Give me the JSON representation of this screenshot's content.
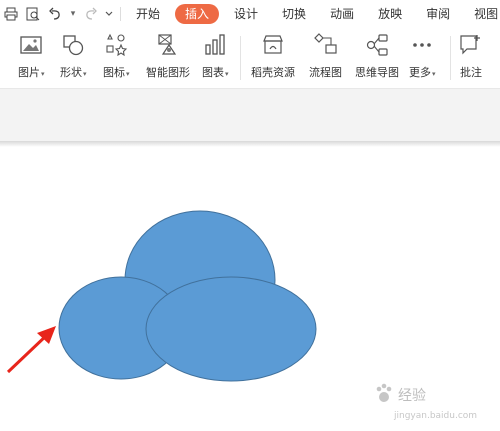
{
  "quick_access": {
    "print_icon": "printer-icon",
    "preview_icon": "print-preview-icon",
    "undo_icon": "undo-icon",
    "redo_icon": "redo-icon",
    "more_icon": "chevron-down-icon"
  },
  "tabs": [
    {
      "label": "开始",
      "active": false
    },
    {
      "label": "插入",
      "active": true
    },
    {
      "label": "设计",
      "active": false
    },
    {
      "label": "切换",
      "active": false
    },
    {
      "label": "动画",
      "active": false
    },
    {
      "label": "放映",
      "active": false
    },
    {
      "label": "审阅",
      "active": false
    },
    {
      "label": "视图",
      "active": false
    }
  ],
  "ribbon": {
    "picture": {
      "label": "图片",
      "icon": "picture-icon",
      "has_dropdown": true
    },
    "shape": {
      "label": "形状",
      "icon": "shape-icon",
      "has_dropdown": true
    },
    "icon": {
      "label": "图标",
      "icon": "icons-icon",
      "has_dropdown": true
    },
    "smartart": {
      "label": "智能图形",
      "icon": "smartart-icon",
      "has_dropdown": false
    },
    "chart": {
      "label": "图表",
      "icon": "chart-icon",
      "has_dropdown": true
    },
    "resources": {
      "label": "稻壳资源",
      "icon": "store-icon",
      "has_dropdown": false
    },
    "flowchart": {
      "label": "流程图",
      "icon": "flowchart-icon",
      "has_dropdown": false
    },
    "mindmap": {
      "label": "思维导图",
      "icon": "mindmap-icon",
      "has_dropdown": false
    },
    "more": {
      "label": "更多",
      "icon": "more-dots-icon",
      "has_dropdown": true
    },
    "comment": {
      "label": "批注",
      "icon": "comment-add-icon",
      "has_dropdown": false
    }
  },
  "slide": {
    "shape_fill": "#5b9bd5",
    "shape_stroke": "#41719c",
    "arrow_color": "#e8251b"
  },
  "watermark": {
    "brand": "Baidu",
    "text": "经验",
    "url": "jingyan.baidu.com"
  },
  "colors": {
    "active_tab": "#ee6a44",
    "band": "#f3f3f3"
  }
}
